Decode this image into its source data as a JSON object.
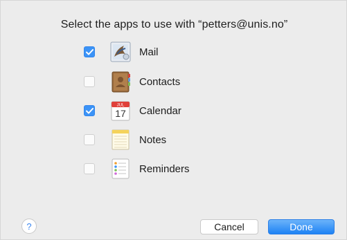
{
  "dialog": {
    "title": "Select the apps to use with “petters@unis.no”"
  },
  "apps": [
    {
      "label": "Mail",
      "checked": true,
      "icon": "mail-icon"
    },
    {
      "label": "Contacts",
      "checked": false,
      "icon": "contacts-icon"
    },
    {
      "label": "Calendar",
      "checked": true,
      "icon": "calendar-icon",
      "icon_month": "JUL",
      "icon_day": "17"
    },
    {
      "label": "Notes",
      "checked": false,
      "icon": "notes-icon"
    },
    {
      "label": "Reminders",
      "checked": false,
      "icon": "reminders-icon"
    }
  ],
  "buttons": {
    "help": "?",
    "cancel": "Cancel",
    "done": "Done"
  },
  "colors": {
    "accent": "#3b93f7",
    "background": "#ececec"
  }
}
